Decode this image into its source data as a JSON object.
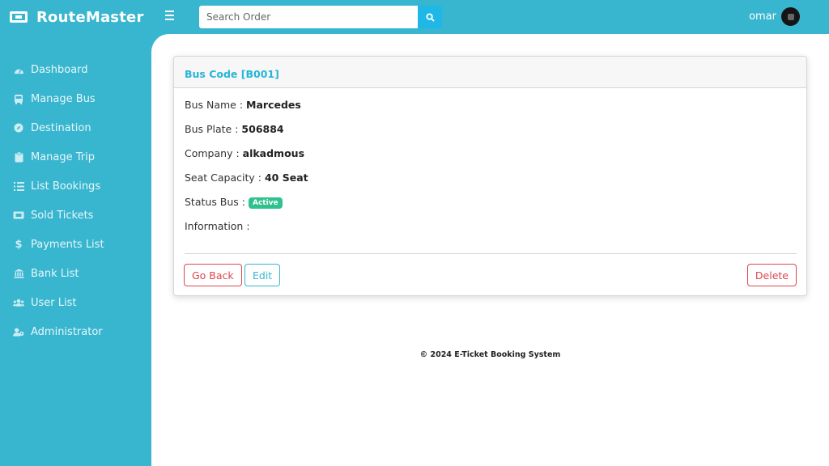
{
  "app": {
    "name": "RouteMaster"
  },
  "search": {
    "placeholder": "Search Order"
  },
  "user": {
    "name": "omar"
  },
  "sidebar": {
    "items": [
      {
        "label": "Dashboard",
        "icon": "dashboard-icon"
      },
      {
        "label": "Manage Bus",
        "icon": "bus-icon"
      },
      {
        "label": "Destination",
        "icon": "compass-icon"
      },
      {
        "label": "Manage Trip",
        "icon": "clipboard-icon"
      },
      {
        "label": "List Bookings",
        "icon": "list-icon"
      },
      {
        "label": "Sold Tickets",
        "icon": "ticket-icon"
      },
      {
        "label": "Payments List",
        "icon": "dollar-icon"
      },
      {
        "label": "Bank List",
        "icon": "bank-icon"
      },
      {
        "label": "User List",
        "icon": "users-icon"
      },
      {
        "label": "Administrator",
        "icon": "admin-icon"
      }
    ]
  },
  "card": {
    "title": "Bus Code [B001]",
    "fields": [
      {
        "label": "Bus Name :",
        "value": "Marcedes"
      },
      {
        "label": "Bus Plate :",
        "value": "506884"
      },
      {
        "label": "Company :",
        "value": "alkadmous"
      },
      {
        "label": "Seat Capacity :",
        "value": "40 Seat"
      },
      {
        "label": "Status Bus :",
        "value": "Active"
      },
      {
        "label": "Information :",
        "value": ""
      }
    ],
    "buttons": {
      "back": "Go Back",
      "edit": "Edit",
      "delete": "Delete"
    }
  },
  "footer": {
    "text": "© 2024 E-Ticket Booking System"
  },
  "colors": {
    "primary": "#38b6cf",
    "accent": "#25b5d9",
    "danger": "#dc4750",
    "success": "#2fc28f"
  }
}
